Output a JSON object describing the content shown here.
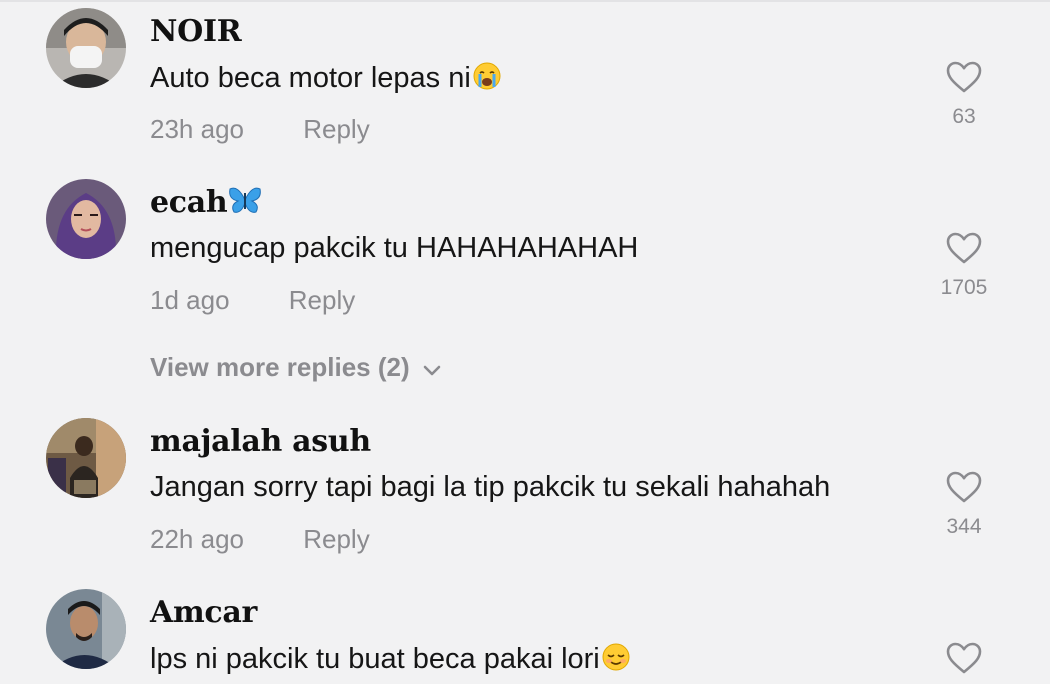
{
  "comments": [
    {
      "username": "NOIR",
      "text": "Auto beca motor lepas ni",
      "emoji": "crying-face-emoji",
      "time": "23h ago",
      "reply_label": "Reply",
      "likes": "63"
    },
    {
      "username": "ecah",
      "username_emoji": "butterfly-emoji",
      "text": "mengucap pakcik tu HAHAHAHAHAH",
      "time": "1d ago",
      "reply_label": "Reply",
      "likes": "1705",
      "view_more_replies": "View more replies (2)"
    },
    {
      "username": "majalah asuh",
      "text": "Jangan sorry tapi bagi la tip pakcik tu sekali hahahah",
      "time": "22h ago",
      "reply_label": "Reply",
      "likes": "344"
    },
    {
      "username": "Amcar",
      "text": "lps ni pakcik tu buat beca pakai lori",
      "emoji": "relieved-face-emoji"
    }
  ],
  "colors": {
    "background": "#f2f2f3",
    "text": "#161616",
    "muted": "#8b8b8f",
    "butterfly": "#3aa0e8"
  }
}
